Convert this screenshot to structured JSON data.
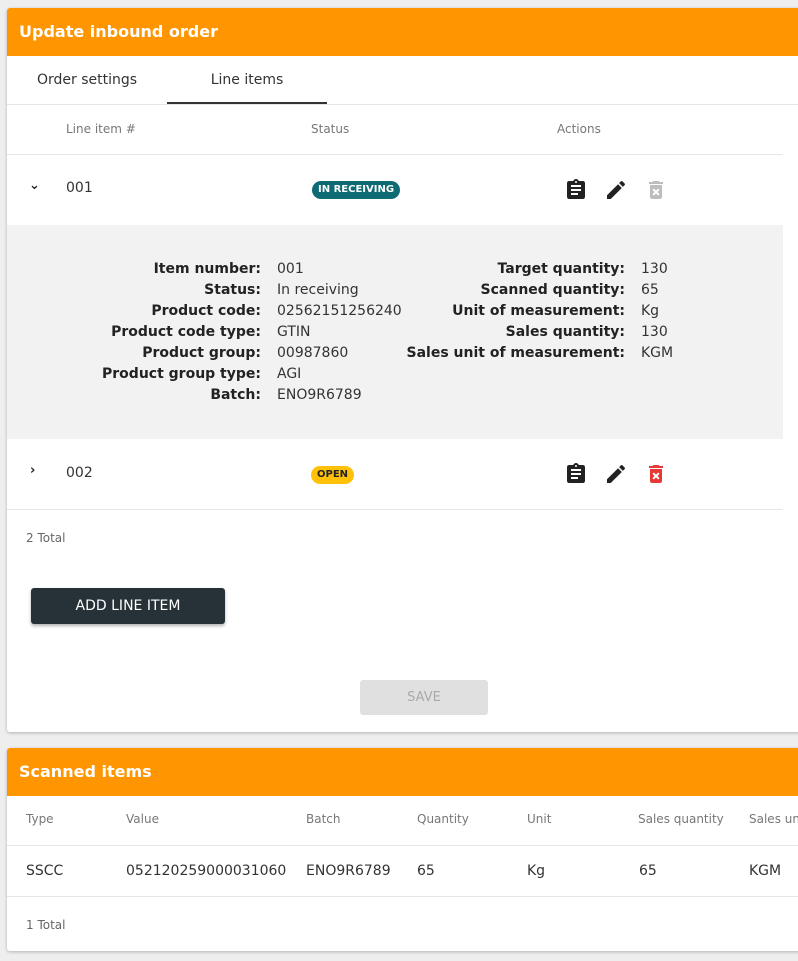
{
  "update_card": {
    "title": "Update inbound order",
    "tabs": [
      {
        "label": "Order settings"
      },
      {
        "label": "Line items"
      }
    ],
    "columns": {
      "line_item": "Line item #",
      "status": "Status",
      "actions": "Actions"
    },
    "rows": [
      {
        "number": "001",
        "status": "IN RECEIVING",
        "status_color": "#0e6b73",
        "expanded": true
      },
      {
        "number": "002",
        "status": "OPEN",
        "status_color": "#ffc107",
        "expanded": false
      }
    ],
    "details": {
      "left": [
        {
          "label": "Item number:",
          "value": "001"
        },
        {
          "label": "Status:",
          "value": "In receiving"
        },
        {
          "label": "Product code:",
          "value": "02562151256240"
        },
        {
          "label": "Product code type:",
          "value": "GTIN"
        },
        {
          "label": "Product group:",
          "value": "00987860"
        },
        {
          "label": "Product group type:",
          "value": "AGI"
        },
        {
          "label": "Batch:",
          "value": "ENO9R6789"
        }
      ],
      "right": [
        {
          "label": "Target quantity:",
          "value": "130"
        },
        {
          "label": "Scanned quantity:",
          "value": "65"
        },
        {
          "label": "Unit of measurement:",
          "value": "Kg"
        },
        {
          "label": "Sales quantity:",
          "value": "130"
        },
        {
          "label": "Sales unit of measurement:",
          "value": "KGM"
        }
      ]
    },
    "total": "2 Total",
    "add_button": "ADD LINE ITEM",
    "save_button": "SAVE",
    "icons": [
      "clipboard-icon",
      "edit-icon",
      "delete-icon"
    ],
    "colors": {
      "accent": "#ff9500",
      "delete_active": "#e53935",
      "delete_disabled": "#bdbdbd"
    }
  },
  "scanned_card": {
    "title": "Scanned items",
    "columns": [
      "Type",
      "Value",
      "Batch",
      "Quantity",
      "Unit",
      "Sales quantity",
      "Sales unit"
    ],
    "rows": [
      [
        "SSCC",
        "052120259000031060",
        "ENO9R6789",
        "65",
        "Kg",
        "65",
        "KGM"
      ]
    ],
    "total": "1 Total"
  }
}
